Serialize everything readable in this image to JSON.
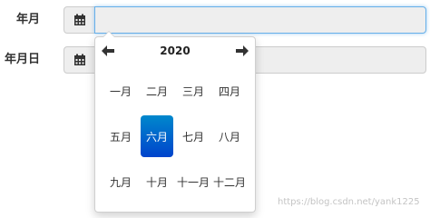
{
  "form": {
    "month_label": "年月",
    "month_value": "",
    "date_label": "年月日",
    "date_value": ""
  },
  "datepicker": {
    "year": "2020",
    "prev_icon": "arrow-left-icon",
    "next_icon": "arrow-right-icon",
    "months": [
      "一月",
      "二月",
      "三月",
      "四月",
      "五月",
      "六月",
      "七月",
      "八月",
      "九月",
      "十月",
      "十一月",
      "十二月"
    ],
    "selected_month": "六月",
    "selected_color_top": "#0088cc",
    "selected_color_bottom": "#0044cc"
  },
  "watermark": "https://blog.csdn.net/yank1225",
  "icons": {
    "addon": "calendar-icon"
  },
  "colors": {
    "focus_border": "#66afe9",
    "addon_bg": "#eeeeee"
  }
}
